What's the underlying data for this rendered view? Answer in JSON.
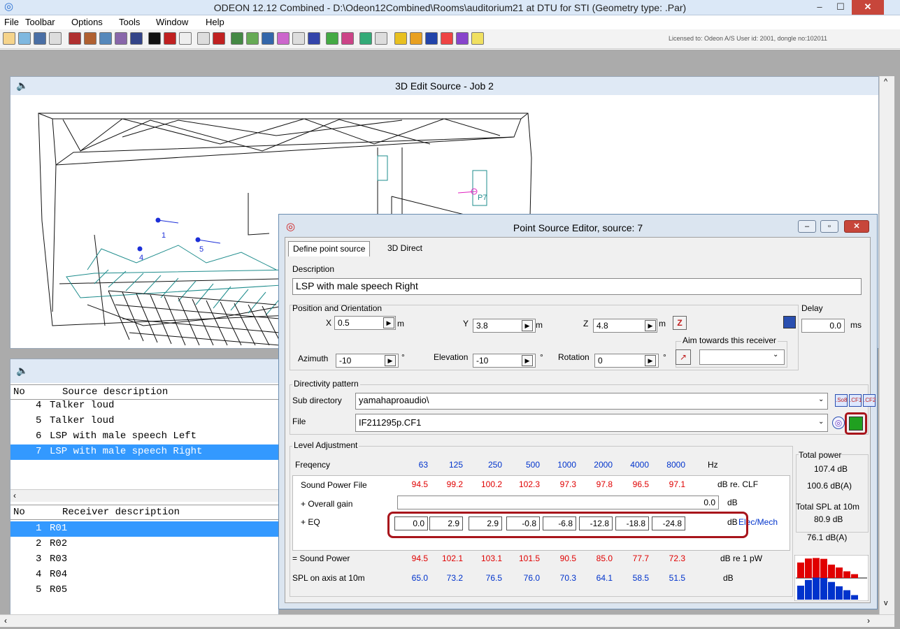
{
  "app": {
    "title": "ODEON 12.12 Combined  -  D:\\Odeon12Combined\\Rooms\\auditorium21 at DTU for STI      (Geometry type: .Par)"
  },
  "menu": [
    "File",
    "Toolbar",
    "Options",
    "Tools",
    "Window",
    "Help"
  ],
  "toolbar": {
    "license": "Licensed to: Odeon A/S   User id: 2001, dongle no:102011"
  },
  "view3d": {
    "title": "3D Edit Source - Job 2",
    "labels": [
      "1",
      "4",
      "5",
      "P7"
    ]
  },
  "sources": {
    "header_no": "No",
    "header_desc": "Source description",
    "rows": [
      {
        "no": "4",
        "desc": "Talker loud"
      },
      {
        "no": "5",
        "desc": "Talker loud"
      },
      {
        "no": "6",
        "desc": "LSP with male speech Left"
      },
      {
        "no": "7",
        "desc": "LSP with male speech Right"
      }
    ]
  },
  "receivers": {
    "header_no": "No",
    "header_desc": "Receiver description",
    "rows": [
      {
        "no": "1",
        "desc": "R01"
      },
      {
        "no": "2",
        "desc": "R02"
      },
      {
        "no": "3",
        "desc": "R03"
      },
      {
        "no": "4",
        "desc": "R04"
      },
      {
        "no": "5",
        "desc": "R05"
      }
    ]
  },
  "dialog": {
    "title": "Point Source Editor, source: 7",
    "tabs": [
      "Define point source",
      "3D Direct"
    ],
    "description_label": "Description",
    "description": "LSP with male speech Right",
    "position_label": "Position and Orientation",
    "x_label": "X",
    "x": "0.5",
    "y_label": "Y",
    "y": "3.8",
    "z_label": "Z",
    "z": "4.8",
    "unit_m": "m",
    "azimuth_label": "Azimuth",
    "azimuth": "-10",
    "elevation_label": "Elevation",
    "elevation": "-10",
    "rotation_label": "Rotation",
    "rotation": "0",
    "degree": "°",
    "aim_label": "Aim towards this receiver",
    "delay_label": "Delay",
    "delay": "0.0",
    "delay_unit": "ms",
    "directivity_label": "Directivity pattern",
    "subdir_label": "Sub directory",
    "subdir": "yamahaproaudio\\",
    "file_label": "File",
    "file": "IF211295p.CF1",
    "dir_buttons": [
      ".So8",
      ".CF1",
      ".CF2"
    ],
    "level_label": "Level Adjustment",
    "freq_label": "Freqency",
    "freqs": [
      "63",
      "125",
      "250",
      "500",
      "1000",
      "2000",
      "4000",
      "8000"
    ],
    "hz": "Hz",
    "swl_file_label": "Sound Power File",
    "swl_file": [
      "94.5",
      "99.2",
      "100.2",
      "102.3",
      "97.3",
      "97.8",
      "96.5",
      "97.1"
    ],
    "swl_file_unit": "dB  re. CLF",
    "gain_label": "+ Overall gain",
    "gain": "0.0",
    "gain_unit": "dB",
    "eq_label": "+ EQ",
    "eq": [
      "0.0",
      "2.9",
      "2.9",
      "-0.8",
      "-6.8",
      "-12.8",
      "-18.8",
      "-24.8"
    ],
    "eq_unit": "dB",
    "elec_mech": "Elec/Mech",
    "swl_label": "= Sound Power",
    "swl": [
      "94.5",
      "102.1",
      "103.1",
      "101.5",
      "90.5",
      "85.0",
      "77.7",
      "72.3"
    ],
    "swl_unit": "dB re 1 pW",
    "spl_label": "SPL on axis at 10m",
    "spl": [
      "65.0",
      "73.2",
      "76.5",
      "76.0",
      "70.3",
      "64.1",
      "58.5",
      "51.5"
    ],
    "spl_unit": "dB",
    "total_power_label": "Total power",
    "total_power": "107.4 dB",
    "total_power_a": "100.6 dB(A)",
    "total_spl_label": "Total SPL at 10m",
    "total_spl": "80.9 dB",
    "total_spl_a": "76.1 dB(A)"
  },
  "colors": {
    "selection": "#3399ff",
    "highlight": "#a8141b",
    "level_red": "#e00000",
    "level_blue": "#0033cc"
  }
}
